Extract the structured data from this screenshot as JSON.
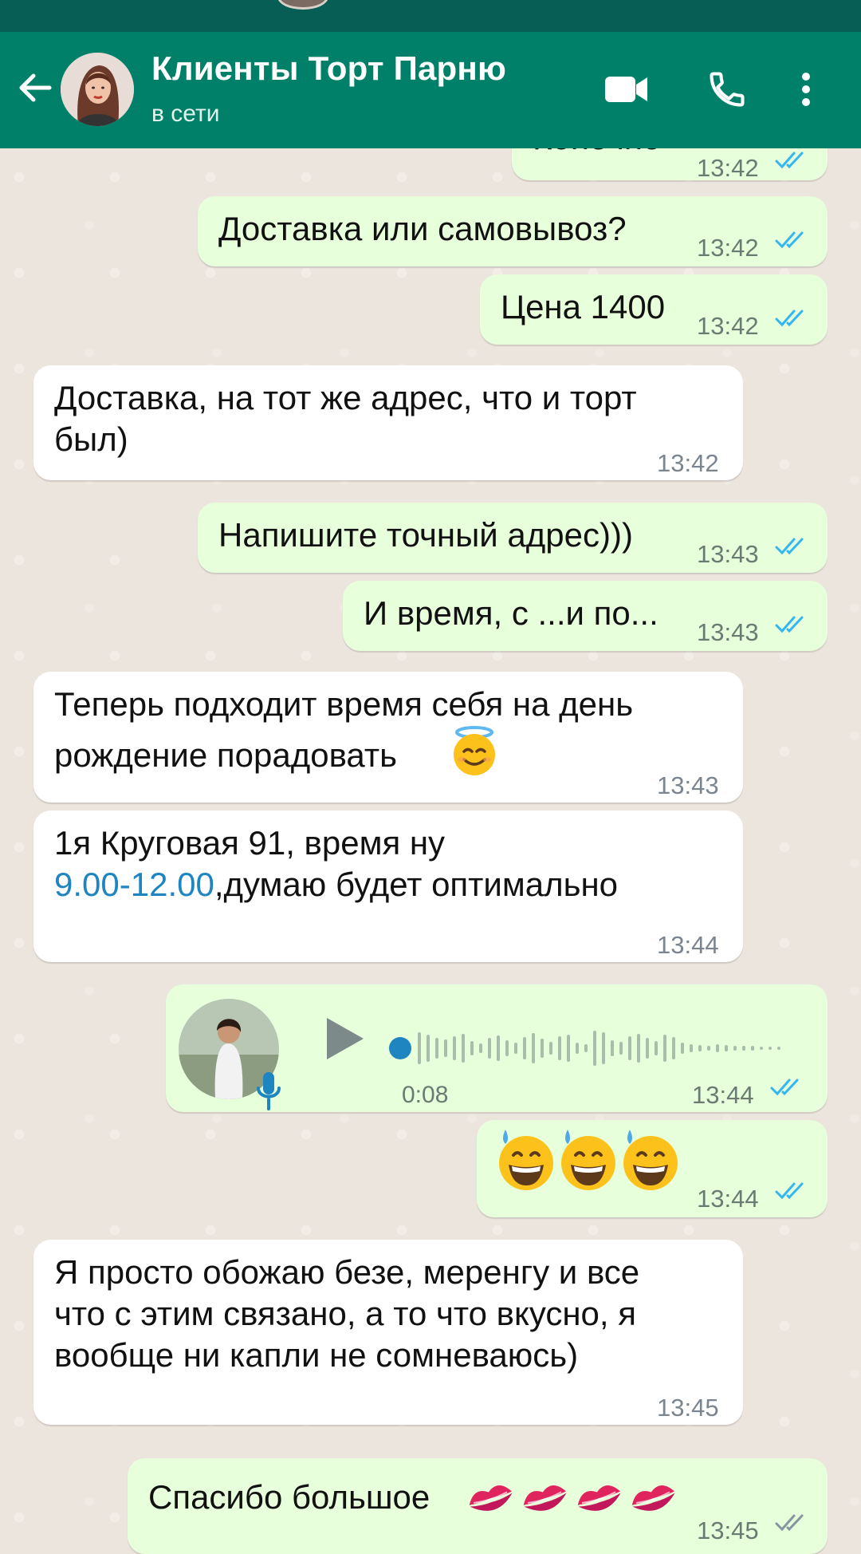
{
  "header": {
    "contact_name": "Клиенты Торт Парню",
    "status": "в сети"
  },
  "messages": [
    {
      "dir": "out",
      "text": "Конечно",
      "time": "13:42"
    },
    {
      "dir": "out",
      "text": "Доставка или самовывоз?",
      "time": "13:42"
    },
    {
      "dir": "out",
      "text": "Цена 1400",
      "time": "13:42"
    },
    {
      "dir": "in",
      "line1": "Доставка, на тот же адрес, что и торт",
      "line2": "был)",
      "time": "13:42"
    },
    {
      "dir": "out",
      "text": "Напишите точный адрес)))",
      "time": "13:43"
    },
    {
      "dir": "out",
      "text": "И время, с ...и по...",
      "time": "13:43"
    },
    {
      "dir": "in",
      "line1": "Теперь подходит время себя на день",
      "line2": "рождение порадовать",
      "time": "13:43"
    },
    {
      "dir": "in",
      "line1": "1я Круговая 91, время ну",
      "link": "9.00-12.00",
      "line2": ",думаю будет оптимально",
      "time": "13:44"
    },
    {
      "dir": "out",
      "type": "voice",
      "duration": "0:08",
      "time": "13:44"
    },
    {
      "dir": "out",
      "type": "emoji",
      "time": "13:44"
    },
    {
      "dir": "in",
      "line1": "Я просто обожаю безе, меренгу и все",
      "line2": "что с этим связано, а то что вкусно, я",
      "line3": "вообще ни капли не сомневаюсь)",
      "time": "13:45"
    },
    {
      "dir": "out",
      "text": "Спасибо большое",
      "time": "13:45"
    }
  ],
  "colors": {
    "header": "#008069",
    "outgoing_bubble": "#e7ffdb",
    "incoming_bubble": "#ffffff",
    "read_ticks": "#34b7f1",
    "sent_ticks": "#8696a0",
    "link": "#1f85c1"
  },
  "icons": [
    "back-arrow-icon",
    "video-call-icon",
    "voice-call-icon",
    "more-options-icon",
    "play-icon",
    "mic-icon",
    "double-check-icon"
  ]
}
